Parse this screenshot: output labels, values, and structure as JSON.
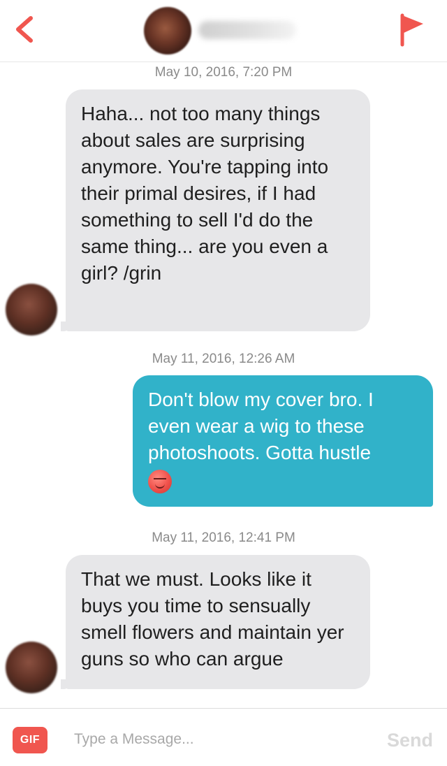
{
  "header": {
    "back_icon": "chevron-left-icon",
    "flag_icon": "flag-icon",
    "accent_color": "#f0564f"
  },
  "messages": [
    {
      "timestamp": "May 10, 2016, 7:20 PM",
      "direction": "incoming",
      "text": "Haha... not too many things about sales are surprising anymore. You're tapping into their primal desires, if I had something to sell I'd do the same thing... are you even a girl? /grin"
    },
    {
      "timestamp": "May 11, 2016, 12:26 AM",
      "direction": "outgoing",
      "text": "Don't blow my cover bro. I even wear a wig to these photoshoots. Gotta hustle",
      "emoji": "smirk-emoji"
    },
    {
      "timestamp": "May 11, 2016, 12:41 PM",
      "direction": "incoming",
      "text": "That we must. Looks like it buys you time to sensually smell flowers and maintain yer guns so who can argue"
    }
  ],
  "composer": {
    "gif_label": "GIF",
    "placeholder": "Type a Message...",
    "send_label": "Send"
  },
  "colors": {
    "incoming_bubble": "#e7e7e9",
    "outgoing_bubble": "#31b2c9",
    "timestamp_text": "#8a8a8a"
  }
}
